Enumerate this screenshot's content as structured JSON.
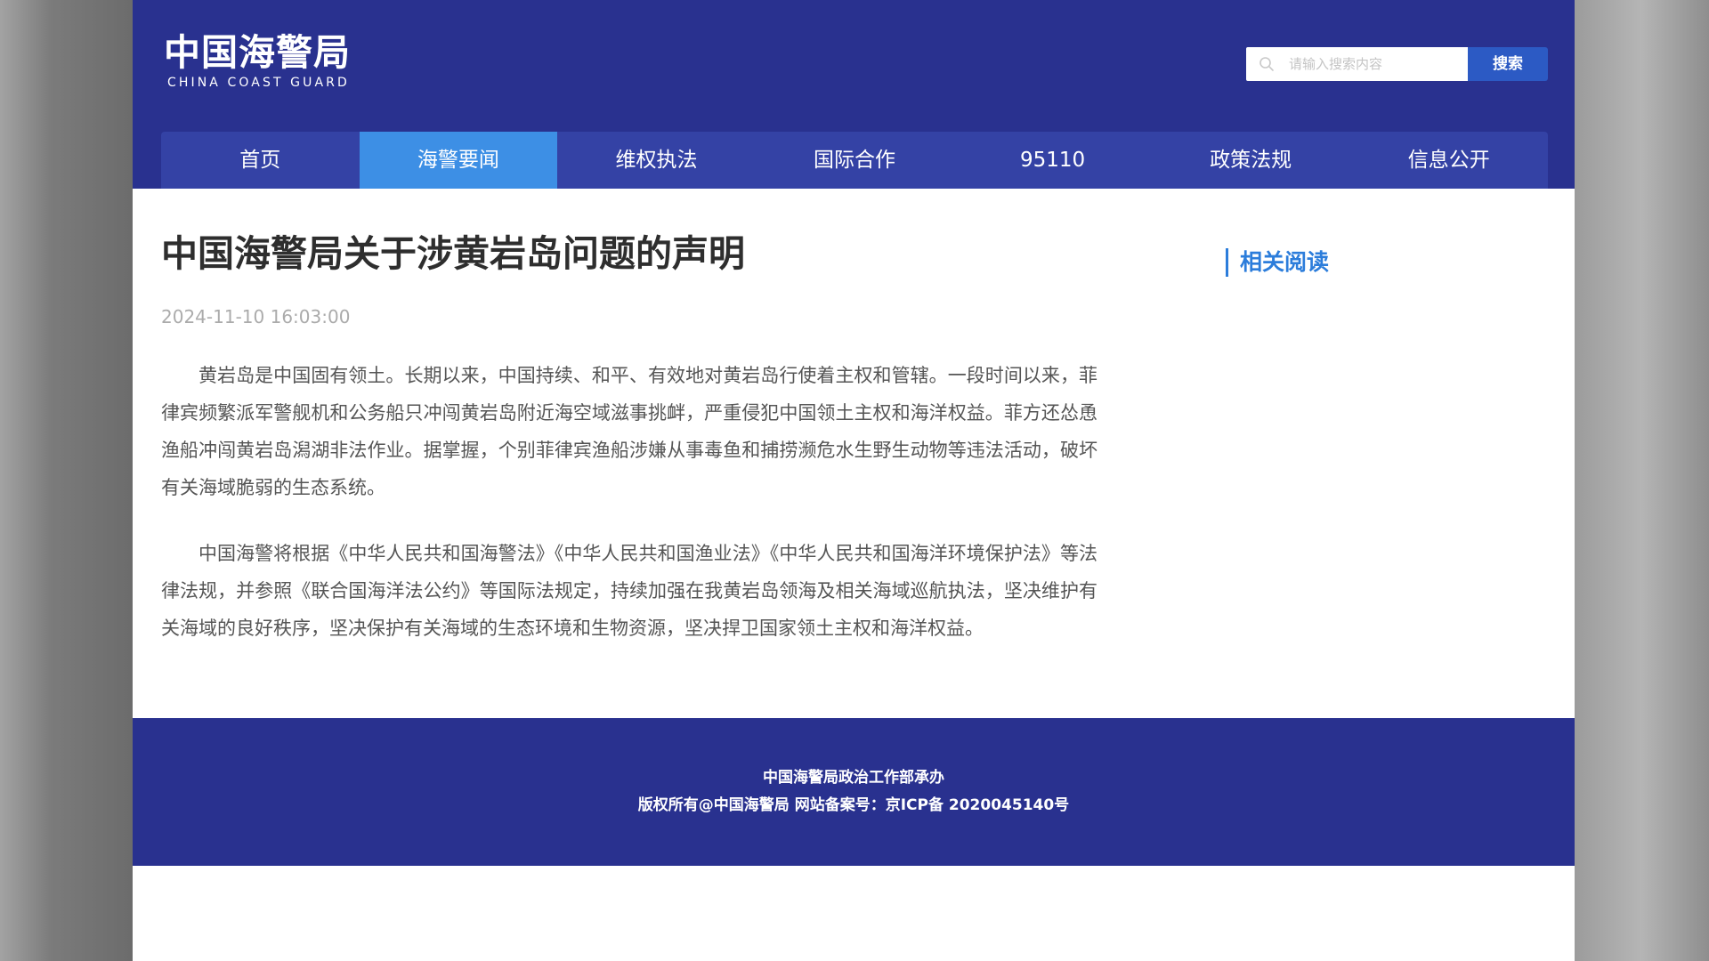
{
  "header": {
    "logo_cn": "中国海警局",
    "logo_en": "CHINA COAST GUARD",
    "search": {
      "placeholder": "请输入搜索内容",
      "button_label": "搜索"
    }
  },
  "nav": {
    "items": [
      {
        "label": "首页",
        "active": false
      },
      {
        "label": "海警要闻",
        "active": true
      },
      {
        "label": "维权执法",
        "active": false
      },
      {
        "label": "国际合作",
        "active": false
      },
      {
        "label": "95110",
        "active": false
      },
      {
        "label": "政策法规",
        "active": false
      },
      {
        "label": "信息公开",
        "active": false
      }
    ]
  },
  "article": {
    "title": "中国海警局关于涉黄岩岛问题的声明",
    "date": "2024-11-10 16:03:00",
    "paragraphs": [
      "黄岩岛是中国固有领土。长期以来，中国持续、和平、有效地对黄岩岛行使着主权和管辖。一段时间以来，菲律宾频繁派军警舰机和公务船只冲闯黄岩岛附近海空域滋事挑衅，严重侵犯中国领土主权和海洋权益。菲方还怂恿渔船冲闯黄岩岛潟湖非法作业。据掌握，个别菲律宾渔船涉嫌从事毒鱼和捕捞濒危水生野生动物等违法活动，破坏有关海域脆弱的生态系统。",
      "中国海警将根据《中华人民共和国海警法》《中华人民共和国渔业法》《中华人民共和国海洋环境保护法》等法律法规，并参照《联合国海洋法公约》等国际法规定，持续加强在我黄岩岛领海及相关海域巡航执法，坚决维护有关海域的良好秩序，坚决保护有关海域的生态环境和生物资源，坚决捍卫国家领土主权和海洋权益。"
    ]
  },
  "sidebar": {
    "heading": "相关阅读"
  },
  "footer": {
    "line1": "中国海警局政治工作部承办",
    "line2": "版权所有@中国海警局 网站备案号：京ICP备 2020045140号"
  },
  "colors": {
    "header_bg": "#29318f",
    "nav_bg": "#3442a5",
    "nav_active": "#3d8fe5",
    "search_button": "#2c5ac4",
    "accent": "#2c7ddb"
  }
}
